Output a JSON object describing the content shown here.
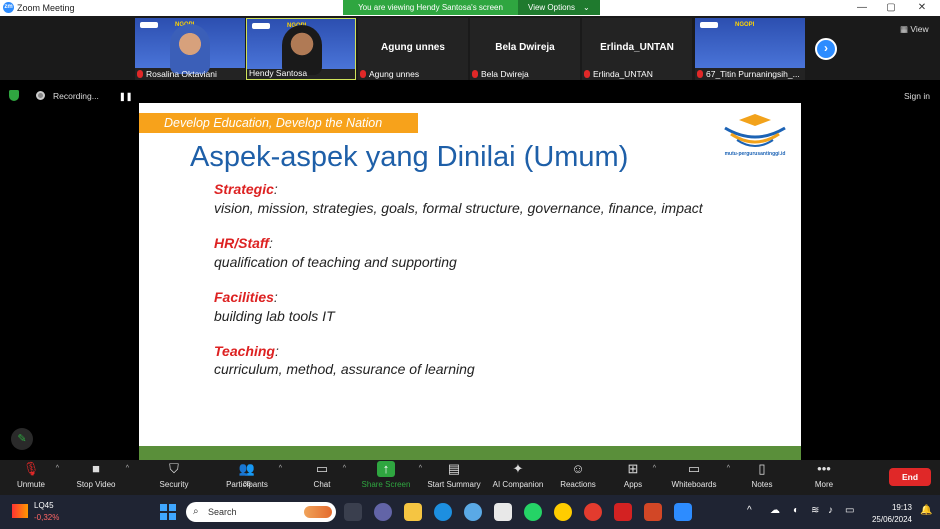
{
  "window": {
    "title": "Zoom Meeting",
    "banner": "You are viewing Hendy Santosa's screen",
    "view_options": "View Options",
    "view": "View"
  },
  "participants": [
    {
      "name": "Rosalina Oktaviani",
      "muted": true
    },
    {
      "name": "Hendy Santosa",
      "muted": false
    },
    {
      "name": "Agung unnes",
      "muted": true
    },
    {
      "name": "Bela Dwireja",
      "muted": true
    },
    {
      "name": "Erlinda_UNTAN",
      "muted": true
    },
    {
      "name": "67_Titin Purnaningsih_...",
      "muted": true
    }
  ],
  "recording": {
    "label": "Recording..."
  },
  "sign_in": "Sign in",
  "slide": {
    "tagline": "Develop Education, Develop the Nation",
    "logo_text": "mutu-pergurusantinggi.id",
    "title": "Aspek-aspek yang Dinilai (Umum)",
    "items": [
      {
        "category": "Strategic",
        "detail": "vision, mission, strategies, goals, formal structure, governance, finance, impact"
      },
      {
        "category": "HR/Staff",
        "detail": "qualification of teaching and supporting"
      },
      {
        "category": "Facilities",
        "detail": "building lab tools IT"
      },
      {
        "category": "Teaching",
        "detail": "curriculum, method, assurance of learning"
      }
    ],
    "colon": ":"
  },
  "toolbar": {
    "unmute": "Unmute",
    "stop_video": "Stop Video",
    "security": "Security",
    "participants": "Participants",
    "participants_count": "36",
    "chat": "Chat",
    "share_screen": "Share Screen",
    "start_summary": "Start Summary",
    "ai_companion": "AI Companion",
    "reactions": "Reactions",
    "apps": "Apps",
    "whiteboards": "Whiteboards",
    "notes": "Notes",
    "more": "More",
    "end": "End"
  },
  "taskbar": {
    "stock_name": "LQ45",
    "stock_change": "-0,32%",
    "search_placeholder": "Search",
    "time": "19:13",
    "date": "25/06/2024"
  },
  "colors": {
    "share_green": "#2fa640",
    "end_red": "#e02828",
    "zoom_blue": "#2d8cff",
    "title_blue": "#1e5fa8",
    "category_red": "#d22222",
    "tagline_orange": "#f7a21b"
  }
}
